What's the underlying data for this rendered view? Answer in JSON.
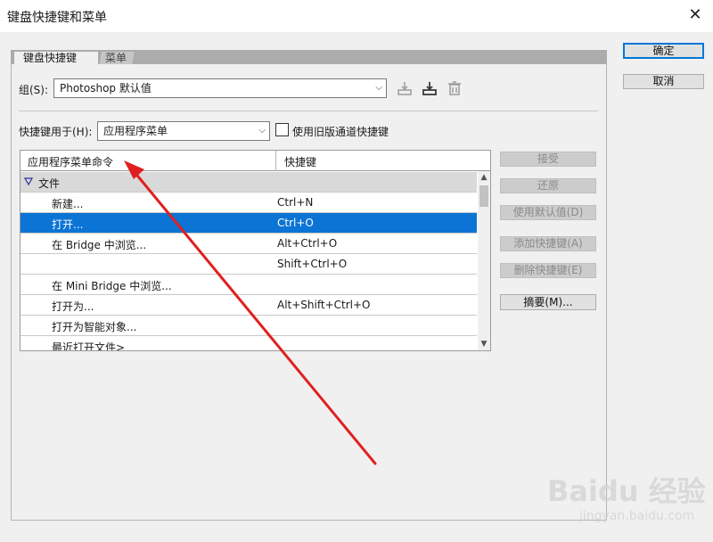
{
  "window": {
    "title": "键盘快捷键和菜单",
    "close_glyph": "✕"
  },
  "tabs": [
    {
      "label": "键盘快捷键"
    },
    {
      "label": "菜单"
    }
  ],
  "set": {
    "label": "组(S):",
    "value": "Photoshop 默认值"
  },
  "shortcuts_for": {
    "label": "快捷键用于(H):",
    "value": "应用程序菜单"
  },
  "legacy_checkbox": {
    "label": "使用旧版通道快捷键",
    "checked": false
  },
  "icons": {
    "save": "save-icon",
    "save_as": "save-as-icon",
    "delete": "trash-icon"
  },
  "table": {
    "headers": [
      "应用程序菜单命令",
      "快捷键"
    ],
    "rows": [
      {
        "command": "文件",
        "shortcut": "",
        "type": "group"
      },
      {
        "command": "新建...",
        "shortcut": "Ctrl+N",
        "type": "item"
      },
      {
        "command": "打开...",
        "shortcut": "Ctrl+O",
        "type": "selected"
      },
      {
        "command": "在 Bridge 中浏览...",
        "shortcut": "Alt+Ctrl+O",
        "type": "item"
      },
      {
        "command": "",
        "shortcut": "Shift+Ctrl+O",
        "type": "item"
      },
      {
        "command": "在 Mini Bridge 中浏览...",
        "shortcut": "",
        "type": "item"
      },
      {
        "command": "打开为...",
        "shortcut": "Alt+Shift+Ctrl+O",
        "type": "item"
      },
      {
        "command": "打开为智能对象...",
        "shortcut": "",
        "type": "item"
      },
      {
        "command": "最近打开文件>",
        "shortcut": "",
        "type": "item"
      }
    ]
  },
  "side_buttons": {
    "accept": "接受",
    "undo": "还原",
    "use_default": "使用默认值(D)",
    "add_shortcut": "添加快捷键(A)",
    "delete_shortcut": "删除快捷键(E)",
    "summarize": "摘要(M)..."
  },
  "dialog_buttons": {
    "ok": "确定",
    "cancel": "取消"
  },
  "watermark": {
    "logo": "Baidu 经验",
    "site": "jingyan.baidu.com"
  },
  "colors": {
    "selection": "#0b74d5",
    "annotation_arrow": "#e02020",
    "primary_border": "#0078d7"
  }
}
